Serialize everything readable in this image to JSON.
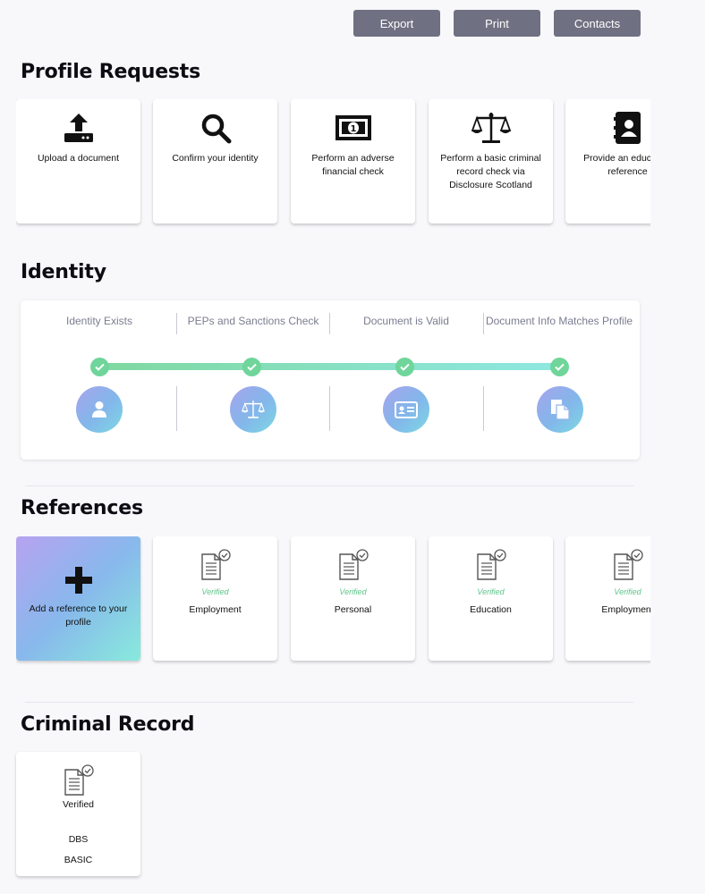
{
  "toolbar": {
    "export": "Export",
    "print": "Print",
    "contacts": "Contacts"
  },
  "sections": {
    "profile_requests": "Profile Requests",
    "identity": "Identity",
    "references": "References",
    "criminal_record": "Criminal Record"
  },
  "profile_requests": [
    {
      "label": "Upload a document",
      "icon": "upload-icon"
    },
    {
      "label": "Confirm your identity",
      "icon": "search-icon"
    },
    {
      "label": "Perform an adverse financial check",
      "icon": "banknote-icon"
    },
    {
      "label": "Perform a basic criminal record check via Disclosure Scotland",
      "icon": "scales-icon"
    },
    {
      "label": "Provide an education reference",
      "icon": "address-book-icon"
    }
  ],
  "identity_steps": [
    {
      "label": "Identity Exists",
      "icon": "user-icon"
    },
    {
      "label": "PEPs and Sanctions Check",
      "icon": "scales-icon"
    },
    {
      "label": "Document is Valid",
      "icon": "id-card-icon"
    },
    {
      "label": "Document Info Matches Profile",
      "icon": "documents-icon"
    }
  ],
  "references": {
    "add_label": "Add a reference to your profile",
    "items": [
      {
        "status": "Verified",
        "label": "Employment"
      },
      {
        "status": "Verified",
        "label": "Personal"
      },
      {
        "status": "Verified",
        "label": "Education"
      },
      {
        "status": "Verified",
        "label": "Employment"
      }
    ]
  },
  "criminal_record": {
    "status": "Verified",
    "type": "DBS",
    "level": "BASIC"
  },
  "colors": {
    "button": "#6f7082",
    "verified": "#5cc48a",
    "track_start": "#7fd8a0",
    "track_end": "#8ee8e2"
  }
}
